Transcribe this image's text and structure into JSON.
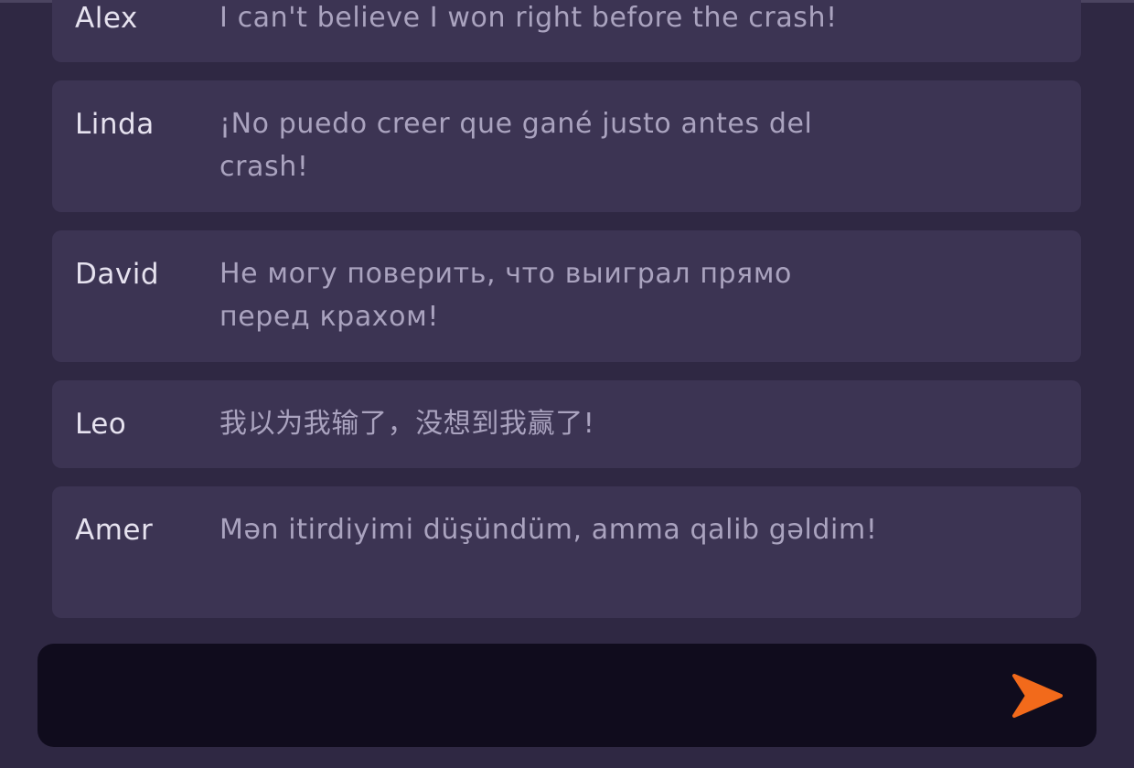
{
  "colors": {
    "background": "#2f2843",
    "message_bg": "#3c3453",
    "input_bg": "#100c1d",
    "username": "#e6e2ef",
    "message_text": "#aaa3bf",
    "send_accent": "#f26a1b"
  },
  "messages": [
    {
      "user": "Alex",
      "text": "I can't believe I won right before the crash!"
    },
    {
      "user": "Linda",
      "text": "¡No puedo creer que gané justo antes del crash!"
    },
    {
      "user": "David",
      "text": "Не могу поверить, что выиграл прямо перед крахом!"
    },
    {
      "user": "Leo",
      "text": "我以为我输了，没想到我赢了!"
    },
    {
      "user": "Amer",
      "text": "Mən itirdiyimi düşündüm, amma qalib gəldim!"
    }
  ],
  "composer": {
    "value": "",
    "placeholder": "",
    "send_icon": "send-arrow-icon"
  }
}
